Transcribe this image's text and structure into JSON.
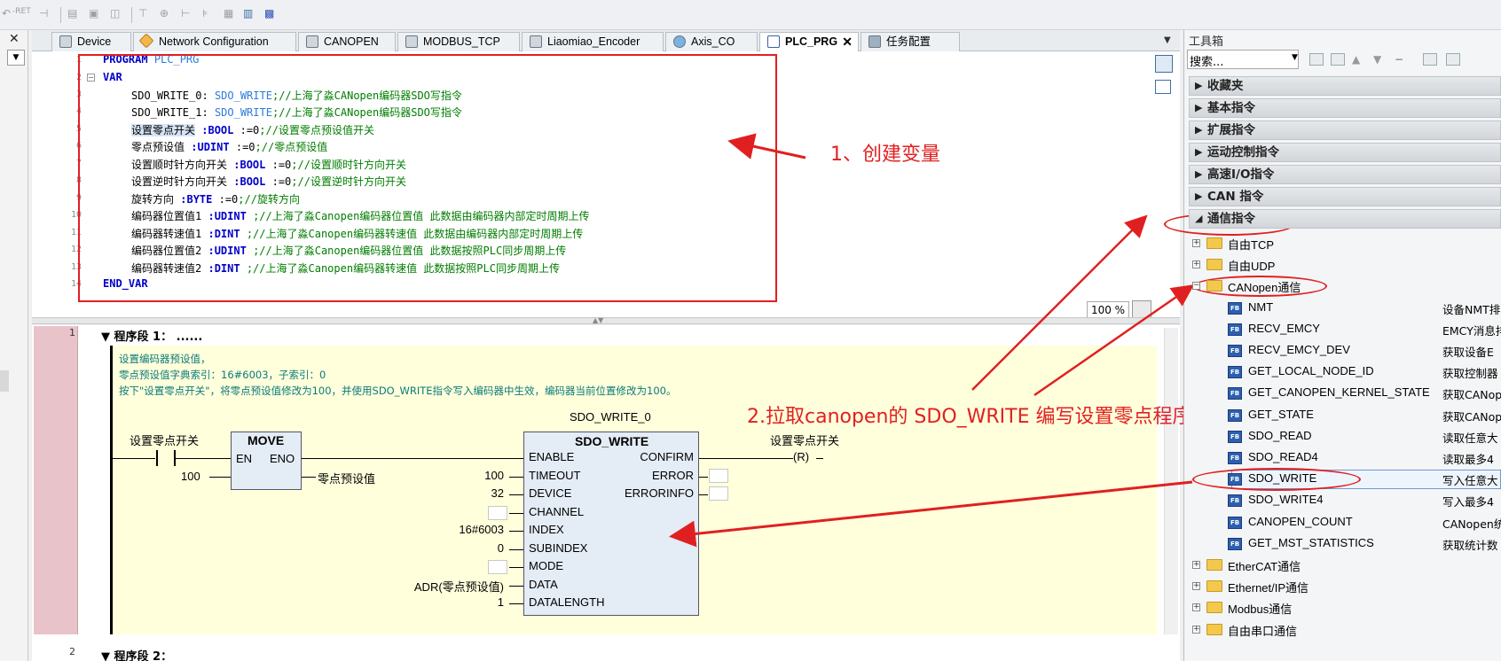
{
  "toolbar": {
    "icons": [
      "undo-icon",
      "ret-icon",
      "edit-icon",
      "box-icon",
      "box-icon",
      "box-icon",
      "branch-icon",
      "branch-icon",
      "branch-icon",
      "branch-icon",
      "grid-icon",
      "grid-icon",
      "grid-icon"
    ],
    "ret_label": "-RET"
  },
  "editor_tabs": [
    {
      "label": "Device",
      "active": false
    },
    {
      "label": "Network Configuration",
      "active": false
    },
    {
      "label": "CANOPEN",
      "active": false
    },
    {
      "label": "MODBUS_TCP",
      "active": false
    },
    {
      "label": "Liaomiao_Encoder",
      "active": false
    },
    {
      "label": "Axis_CO",
      "active": false
    },
    {
      "label": "PLC_PRG",
      "active": true
    },
    {
      "label": "任务配置",
      "active": false
    }
  ],
  "declaration": {
    "lines": [
      {
        "n": "1",
        "text": "PROGRAM PLC_PRG"
      },
      {
        "n": "2",
        "text": "VAR"
      },
      {
        "n": "3",
        "var": "SDO_WRITE_0:",
        "type": "SDO_WRITE",
        "comment": ";//上海了淼CANopen编码器SDO写指令"
      },
      {
        "n": "4",
        "var": "SDO_WRITE_1:",
        "type": "SDO_WRITE",
        "comment": ";//上海了淼CANopen编码器SDO写指令"
      },
      {
        "n": "5",
        "var": "设置零点开关",
        "type": ":BOOL",
        "init": ":=0",
        "comment": ";//设置零点预设值开关"
      },
      {
        "n": "6",
        "var": "零点预设值",
        "type": ":UDINT",
        "init": ":=0",
        "comment": ";//零点预设值"
      },
      {
        "n": "7",
        "var": "设置顺时针方向开关",
        "type": ":BOOL",
        "init": ":=0",
        "comment": ";//设置顺时针方向开关"
      },
      {
        "n": "8",
        "var": "设置逆时针方向开关",
        "type": ":BOOL",
        "init": ":=0",
        "comment": ";//设置逆时针方向开关"
      },
      {
        "n": "9",
        "var": "旋转方向",
        "type": ":BYTE",
        "init": ":=0",
        "comment": ";//旋转方向"
      },
      {
        "n": "10",
        "var": "编码器位置值1",
        "type": ":UDINT",
        "comment": ";//上海了淼Canopen编码器位置值 此数据由编码器内部定时周期上传"
      },
      {
        "n": "11",
        "var": "编码器转速值1",
        "type": ":DINT",
        "comment": ";//上海了淼Canopen编码器转速值 此数据由编码器内部定时周期上传"
      },
      {
        "n": "12",
        "var": "编码器位置值2",
        "type": ":UDINT",
        "comment": ";//上海了淼Canopen编码器位置值 此数据按照PLC同步周期上传"
      },
      {
        "n": "13",
        "var": "编码器转速值2",
        "type": ":DINT",
        "comment": ";//上海了淼Canopen编码器转速值 此数据按照PLC同步周期上传"
      },
      {
        "n": "14",
        "text": "END_VAR"
      }
    ],
    "zoom": "100 %"
  },
  "annotations": {
    "step1": "1、创建变量",
    "step2": "2.拉取canopen的 SDO_WRITE 编写设置零点程序"
  },
  "ladder": {
    "network1_num": "1",
    "network1_title": "程序段 1：",
    "network1_dots": "......",
    "network2_num": "2",
    "network2_title": "程序段 2：",
    "comments": [
      "设置编码器预设值，",
      "零点预设值字典索引：16#6003，子索引：0",
      "按下\"设置零点开关\"，将零点预设值修改为100，并使用SDO_WRITE指令写入编码器中生效，编码器当前位置修改为100。"
    ],
    "contact_label": "设置零点开关",
    "move": {
      "title": "MOVE",
      "en": "EN",
      "eno": "ENO",
      "input": "100",
      "output": "零点预设值"
    },
    "sdo": {
      "instance": "SDO_WRITE_0",
      "title": "SDO_WRITE",
      "inputs": [
        {
          "pin": "ENABLE",
          "value": ""
        },
        {
          "pin": "TIMEOUT",
          "value": "100"
        },
        {
          "pin": "DEVICE",
          "value": "32"
        },
        {
          "pin": "CHANNEL",
          "value": ""
        },
        {
          "pin": "INDEX",
          "value": "16#6003"
        },
        {
          "pin": "SUBINDEX",
          "value": "0"
        },
        {
          "pin": "MODE",
          "value": ""
        },
        {
          "pin": "DATA",
          "value": "ADR(零点预设值)"
        },
        {
          "pin": "DATALENGTH",
          "value": "1"
        }
      ],
      "outputs": [
        "CONFIRM",
        "ERROR",
        "ERRORINFO"
      ]
    },
    "coil_label": "设置零点开关",
    "coil_symbol": "(R)"
  },
  "toolbox": {
    "title": "工具箱",
    "search_label": "搜索...",
    "categories": [
      "收藏夹",
      "基本指令",
      "扩展指令",
      "运动控制指令",
      "高速I/O指令",
      "CAN 指令",
      "通信指令"
    ],
    "tree": [
      {
        "label": "自由TCP",
        "kind": "folder",
        "expanded": false
      },
      {
        "label": "自由UDP",
        "kind": "folder",
        "expanded": false
      },
      {
        "label": "CANopen通信",
        "kind": "folder",
        "expanded": true
      },
      {
        "label": "NMT",
        "kind": "fb",
        "desc": "设备NMT排"
      },
      {
        "label": "RECV_EMCY",
        "kind": "fb",
        "desc": "EMCY消息排"
      },
      {
        "label": "RECV_EMCY_DEV",
        "kind": "fb",
        "desc": "获取设备E"
      },
      {
        "label": "GET_LOCAL_NODE_ID",
        "kind": "fb",
        "desc": "获取控制器"
      },
      {
        "label": "GET_CANOPEN_KERNEL_STATE",
        "kind": "fb",
        "desc": "获取CANop"
      },
      {
        "label": "GET_STATE",
        "kind": "fb",
        "desc": "获取CANop"
      },
      {
        "label": "SDO_READ",
        "kind": "fb",
        "desc": "读取任意大"
      },
      {
        "label": "SDO_READ4",
        "kind": "fb",
        "desc": "读取最多4"
      },
      {
        "label": "SDO_WRITE",
        "kind": "fb",
        "desc": "写入任意大"
      },
      {
        "label": "SDO_WRITE4",
        "kind": "fb",
        "desc": "写入最多4"
      },
      {
        "label": "CANOPEN_COUNT",
        "kind": "fb",
        "desc": "CANopen统"
      },
      {
        "label": "GET_MST_STATISTICS",
        "kind": "fb",
        "desc": "获取统计数"
      },
      {
        "label": "EtherCAT通信",
        "kind": "folder",
        "expanded": false
      },
      {
        "label": "Ethernet/IP通信",
        "kind": "folder",
        "expanded": false
      },
      {
        "label": "Modbus通信",
        "kind": "folder",
        "expanded": false
      },
      {
        "label": "自由串口通信",
        "kind": "folder",
        "expanded": false
      }
    ]
  },
  "colors": {
    "annotation": "#e02020",
    "keyword": "#0000c8",
    "comment": "#007d00",
    "fb_type": "#2e7bd6",
    "network_bg": "#ffffdc"
  }
}
